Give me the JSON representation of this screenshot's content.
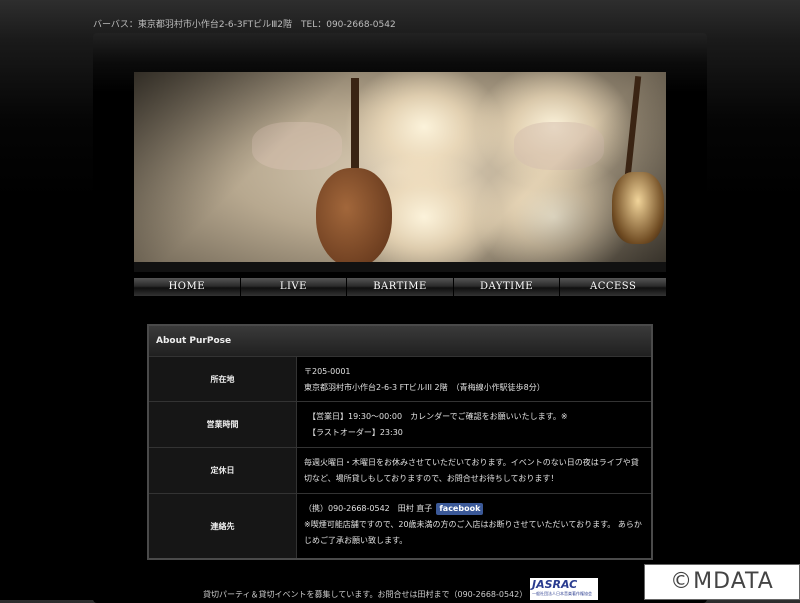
{
  "header": {
    "address": "バーバス：東京都羽村市小作台2-6-3FTビルⅢ2階　TEL：090-2668-0542"
  },
  "nav": {
    "items": [
      "HOME",
      "LIVE",
      "BARTIME",
      "DAYTIME",
      "ACCESS"
    ]
  },
  "about": {
    "title": "About PurPose",
    "rows": [
      {
        "label": "所在地",
        "lines": [
          "〒205-0001",
          "東京都羽村市小作台2-6-3 FTビルIII 2階　（青梅線小作駅徒歩8分）"
        ]
      },
      {
        "label": "営業時間",
        "lines": [
          "　【営業日】19:30〜00:00　カレンダーでご確認をお願いいたします。※",
          "　【ラストオーダー】23:30"
        ]
      },
      {
        "label": "定休日",
        "lines": [
          "毎週火曜日・木曜日をお休みさせていただいております。イベントのない日の夜はライブや貸",
          "切など、場所貸しもしておりますので、お問合せお待ちしております！"
        ]
      },
      {
        "label": "連絡先",
        "contact": "（携）090-2668-0542　田村 直子",
        "facebook": "facebook",
        "lines": [
          "※喫煙可能店舗ですので、20歳未満の方のご入店はお断りさせていただいております。 あらか",
          "じめご了承お願い致します。"
        ]
      }
    ]
  },
  "footer": {
    "text": "貸切パーティ＆貸切イベントを募集しています。お問合せは田村まで（090-2668-0542）",
    "jasrac": "JASRAC",
    "jasrac_sub": "一般社団法人日本音楽著作権協会"
  },
  "watermark": "©MDATA"
}
